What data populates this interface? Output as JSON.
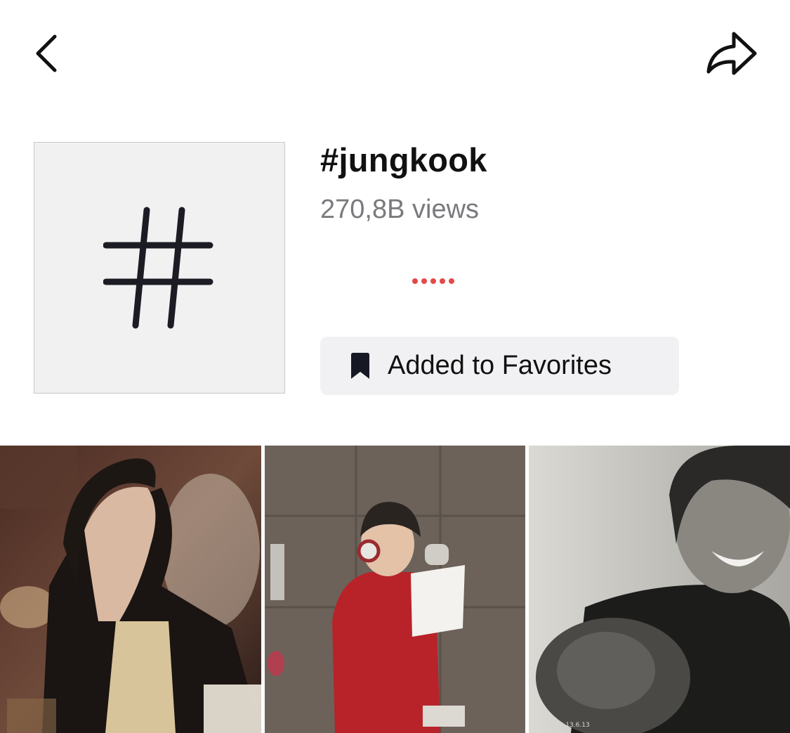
{
  "header": {
    "back_icon": "chevron-left-icon",
    "share_icon": "share-arrow-icon"
  },
  "hashtag": {
    "icon": "hashtag-icon",
    "title": "#jungkook",
    "views": "270,8B views"
  },
  "favorites_button": {
    "icon": "bookmark-icon",
    "label": "Added to Favorites"
  },
  "video_grid": {
    "items": [
      {
        "scene": "person leaning head back in dim warm-lit room",
        "overlay_text": ""
      },
      {
        "scene": "person in red jacket with headphones singing at studio microphone holding paper",
        "overlay_text": ""
      },
      {
        "scene": "smiling person in black, grayscale close-up",
        "overlay_text": "10.13.6.13"
      }
    ]
  },
  "colors": {
    "loading_dots": "#e24a4a",
    "button_bg": "#f1f1f3",
    "thumb_bg": "#f1f1f2",
    "views_text": "#7a7a7e"
  }
}
